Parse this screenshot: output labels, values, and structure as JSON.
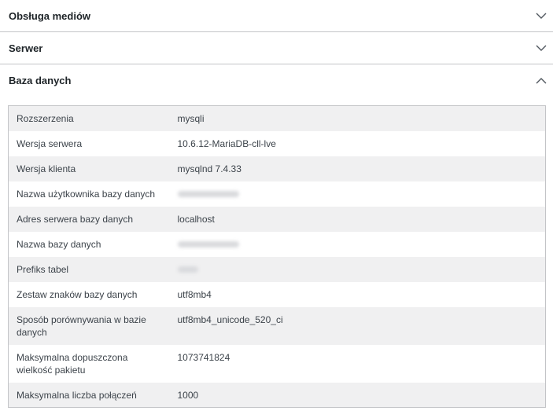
{
  "sections": [
    {
      "title": "Obsługa mediów",
      "state": "collapsed",
      "icon": "chevron-down-icon"
    },
    {
      "title": "Serwer",
      "state": "collapsed",
      "icon": "chevron-down-icon"
    },
    {
      "title": "Baza danych",
      "state": "expanded",
      "icon": "chevron-up-icon"
    }
  ],
  "database": {
    "rows": [
      {
        "key": "Rozszerzenia",
        "value": "mysqli"
      },
      {
        "key": "Wersja serwera",
        "value": "10.6.12-MariaDB-cll-lve"
      },
      {
        "key": "Wersja klienta",
        "value": "mysqlnd 7.4.33"
      },
      {
        "key": "Nazwa użytkownika bazy danych",
        "value": ""
      },
      {
        "key": "Adres serwera bazy danych",
        "value": "localhost"
      },
      {
        "key": "Nazwa bazy danych",
        "value": ""
      },
      {
        "key": "Prefiks tabel",
        "value": ""
      },
      {
        "key": "Zestaw znaków bazy danych",
        "value": "utf8mb4"
      },
      {
        "key": "Sposób porównywania w bazie danych",
        "value": "utf8mb4_unicode_520_ci"
      },
      {
        "key": "Maksymalna dopuszczona wielkość pakietu",
        "value": "1073741824"
      },
      {
        "key": "Maksymalna liczba połączeń",
        "value": "1000"
      }
    ]
  },
  "colors": {
    "border": "#c3c4c7",
    "stripe": "#f0f0f1",
    "text": "#1d2327",
    "icon": "#50575e"
  }
}
